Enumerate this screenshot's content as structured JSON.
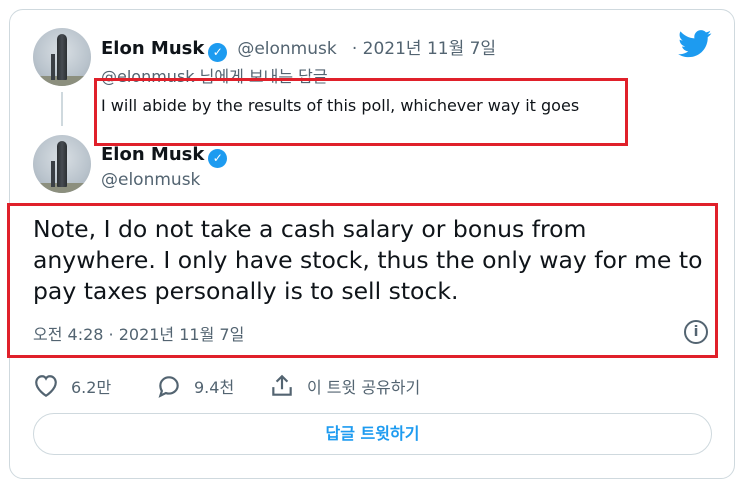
{
  "parent_tweet": {
    "author_name": "Elon Musk",
    "handle": "@elonmusk",
    "date": "· 2021년 11월 7일",
    "replying_to": "@elonmusk 님에게 보내는 답글",
    "text": "I will abide by the results of this poll, whichever way it goes"
  },
  "main_tweet": {
    "author_name": "Elon Musk",
    "handle": "@elonmusk",
    "text": "Note, I do not take a cash salary or bonus from anywhere. I only have stock, thus the only way for me to pay taxes personally is to sell stock.",
    "timestamp": "오전 4:28 · 2021년 11월 7일"
  },
  "actions": {
    "like_count": "6.2만",
    "reply_count": "9.4천",
    "share_label": "이 트윗 공유하기"
  },
  "reply_button_label": "답글 트윗하기",
  "icons": {
    "brand": "twitter-bird-icon",
    "verified": "verified-badge-icon",
    "info": "info-icon",
    "like": "heart-icon",
    "reply": "speech-bubble-icon",
    "share": "share-icon"
  },
  "colors": {
    "brand_blue": "#1d9bf0",
    "highlight_red": "#e0202a",
    "muted_text": "#536471",
    "border": "#cfd9de"
  }
}
